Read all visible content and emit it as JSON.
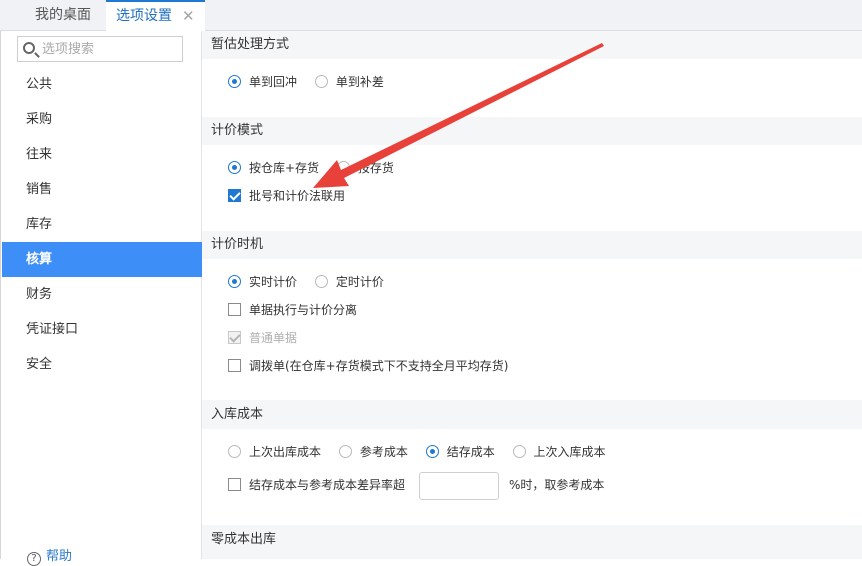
{
  "tabs": {
    "home_label": "我的桌面",
    "active_label": "选项设置",
    "close_glyph": "✕"
  },
  "sidebar": {
    "search_placeholder": "选项搜索",
    "items": [
      {
        "label": "公共"
      },
      {
        "label": "采购"
      },
      {
        "label": "往来"
      },
      {
        "label": "销售"
      },
      {
        "label": "库存"
      },
      {
        "label": "核算",
        "active": true
      },
      {
        "label": "财务"
      },
      {
        "label": "凭证接口"
      },
      {
        "label": "安全"
      }
    ],
    "help_label": "帮助",
    "help_glyph": "?"
  },
  "sections": {
    "estimate": {
      "title": "暂估处理方式",
      "options": [
        "单到回冲",
        "单到补差"
      ],
      "selected": "单到回冲"
    },
    "pricing_mode": {
      "title": "计价模式",
      "options": [
        "按仓库+存货",
        "按存货"
      ],
      "selected": "按仓库+存货",
      "batch_checkbox": {
        "label": "批号和计价法联用",
        "checked": true
      }
    },
    "pricing_timing": {
      "title": "计价时机",
      "options": [
        "实时计价",
        "定时计价"
      ],
      "selected": "实时计价",
      "separate_checkbox": {
        "label": "单据执行与计价分离",
        "checked": false
      },
      "normal_checkbox": {
        "label": "普通单据",
        "checked": true,
        "disabled": true
      },
      "transfer_checkbox": {
        "label": "调拨单(在仓库+存货模式下不支持全月平均存货)",
        "checked": false
      }
    },
    "inbound_cost": {
      "title": "入库成本",
      "options": [
        "上次出库成本",
        "参考成本",
        "结存成本",
        "上次入库成本"
      ],
      "selected": "结存成本",
      "variance_checkbox": {
        "label": "结存成本与参考成本差异率超",
        "checked": false
      },
      "variance_value": "",
      "variance_suffix": "%时，取参考成本"
    },
    "zero_cost": {
      "title": "零成本出库"
    }
  },
  "colors": {
    "accent": "#1f78d1",
    "active_nav": "#3e8ef7",
    "annotation_arrow": "#e8413a"
  }
}
